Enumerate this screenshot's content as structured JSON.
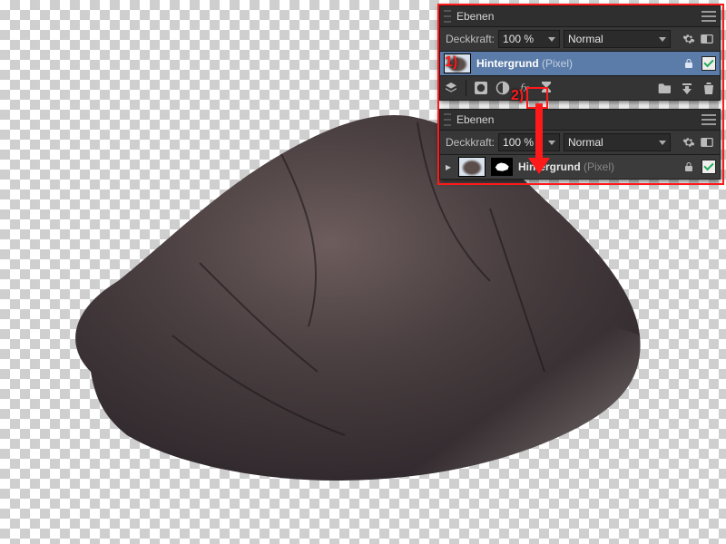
{
  "annotations": {
    "step1": "1)",
    "step2": "2)"
  },
  "panel1": {
    "title": "Ebenen",
    "opacity_label": "Deckkraft:",
    "opacity_value": "100 %",
    "blend_mode": "Normal",
    "layer": {
      "name": "Hintergrund",
      "type": "(Pixel)"
    }
  },
  "panel2": {
    "title": "Ebenen",
    "opacity_label": "Deckkraft:",
    "opacity_value": "100 %",
    "blend_mode": "Normal",
    "layer": {
      "name": "Hintergrund",
      "type": "(Pixel)"
    }
  },
  "icons": {
    "panel_menu": "panel-menu-icon",
    "gear": "gear-icon",
    "lock": "lock-icon",
    "stack": "layer-stack-icon",
    "mask_add": "mask-add-icon",
    "adjust": "adjustment-icon",
    "fx": "fx",
    "hourglass": "live-filter-icon",
    "folder": "group-folder-icon",
    "push": "merge-down-icon",
    "trash": "delete-icon"
  }
}
